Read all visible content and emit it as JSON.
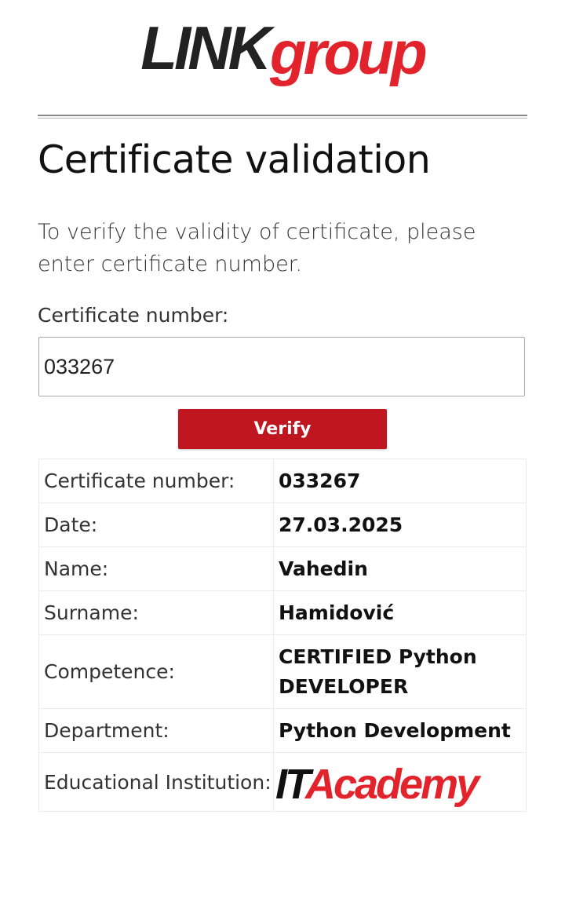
{
  "logo": {
    "part1": "LINK",
    "part2": "group"
  },
  "page_title": "Certificate validation",
  "intro_text": "To verify the validity of certificate, please enter certificate number.",
  "form": {
    "label": "Certificate number:",
    "input_value": "033267",
    "verify_label": "Verify"
  },
  "results": {
    "rows": [
      {
        "label": "Certificate number:",
        "value": "033267"
      },
      {
        "label": "Date:",
        "value": "27.03.2025"
      },
      {
        "label": "Name:",
        "value": "Vahedin"
      },
      {
        "label": "Surname:",
        "value": "Hamidović"
      },
      {
        "label": "Competence:",
        "value": "CERTIFIED Python DEVELOPER"
      },
      {
        "label": "Department:",
        "value": "Python Development"
      }
    ],
    "institution": {
      "label": "Educational Institution:",
      "logo_part1": "IT",
      "logo_part2": "Academy"
    }
  },
  "colors": {
    "brand_red": "#e3232b",
    "button_red": "#c0161f",
    "text_dark": "#111111"
  }
}
